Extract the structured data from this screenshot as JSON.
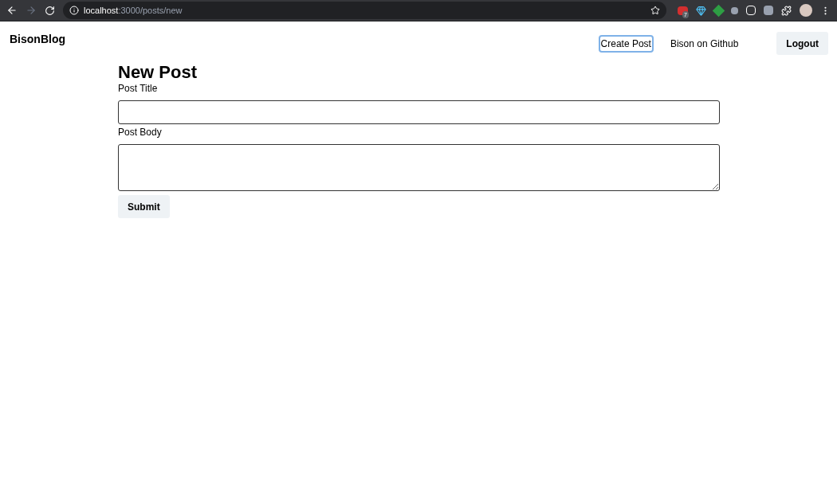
{
  "browser": {
    "url_host": "localhost",
    "url_path": ":3000/posts/new",
    "extension_badge": "7"
  },
  "header": {
    "brand": "BisonBlog",
    "links": [
      {
        "label": "Create Post",
        "focused": true
      },
      {
        "label": "Bison on Github",
        "focused": false
      }
    ],
    "logout": "Logout"
  },
  "form": {
    "title": "New Post",
    "fields": [
      {
        "label": "Post Title",
        "kind": "input"
      },
      {
        "label": "Post Body",
        "kind": "textarea"
      }
    ],
    "submit": "Submit"
  }
}
